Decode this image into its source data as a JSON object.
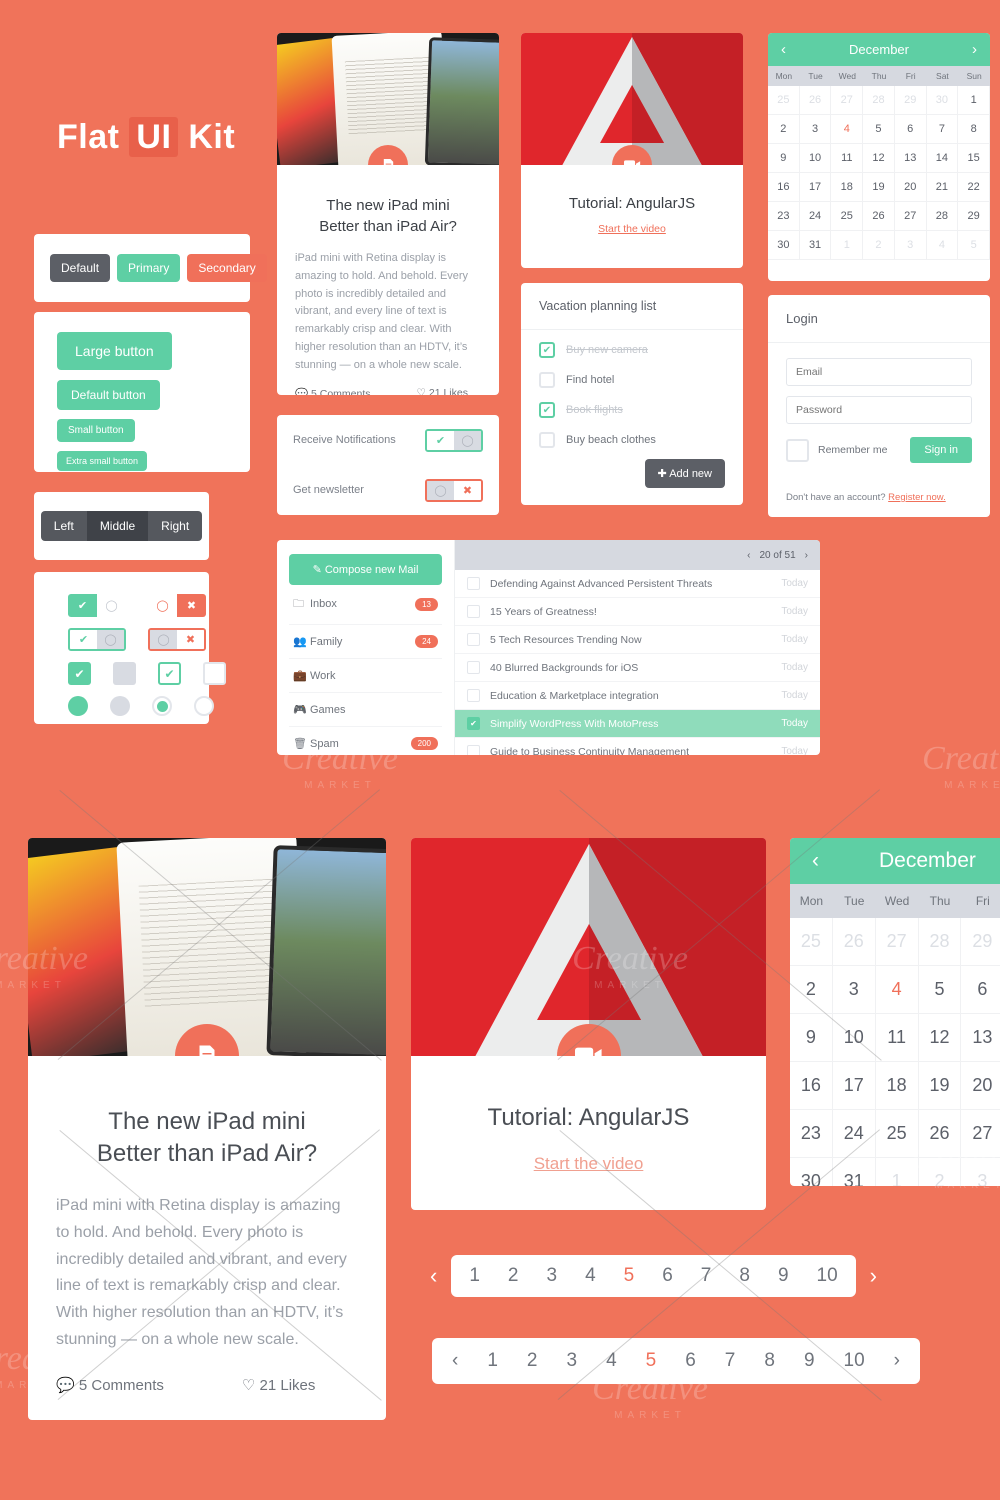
{
  "title": {
    "pre": "Flat ",
    "highlight": "UI",
    "post": " Kit"
  },
  "buttons": {
    "default": "Default",
    "primary": "Primary",
    "secondary": "Secondary"
  },
  "sizes": {
    "large": "Large button",
    "default": "Default button",
    "small": "Small button",
    "xsmall": "Extra small button"
  },
  "segmented": {
    "left": "Left",
    "middle": "Middle",
    "right": "Right"
  },
  "article": {
    "title_line1": "The new iPad mini",
    "title_line2": "Better than iPad Air?",
    "body": "iPad mini with Retina display is amazing to hold. And behold. Every photo is incredibly detailed and vibrant, and every line of text is remarkably crisp and clear. With higher resolution than an HDTV, it’s stunning — on a whole new scale.",
    "comments": "5 Comments",
    "likes": "21 Likes",
    "badge_icon": "document-icon"
  },
  "notifications": {
    "row1_label": "Receive Notifications",
    "row2_label": "Get newsletter"
  },
  "angular": {
    "title": "Tutorial: AngularJS",
    "link": "Start the video",
    "badge_icon": "video-camera-icon"
  },
  "vacation": {
    "header": "Vacation planning list",
    "items": [
      {
        "label": "Buy new camera",
        "checked": true
      },
      {
        "label": "Find hotel",
        "checked": false
      },
      {
        "label": "Book flights",
        "checked": true
      },
      {
        "label": "Buy beach clothes",
        "checked": false
      }
    ],
    "add_label": "Add new"
  },
  "calendar": {
    "month": "December",
    "prev_icon": "chevron-left-icon",
    "next_icon": "chevron-right-icon",
    "dow": [
      "Mon",
      "Tue",
      "Wed",
      "Thu",
      "Fri",
      "Sat",
      "Sun"
    ],
    "weeks": [
      [
        {
          "d": "25",
          "m": true
        },
        {
          "d": "26",
          "m": true
        },
        {
          "d": "27",
          "m": true
        },
        {
          "d": "28",
          "m": true
        },
        {
          "d": "29",
          "m": true
        },
        {
          "d": "30",
          "m": true
        },
        {
          "d": "1"
        }
      ],
      [
        {
          "d": "2"
        },
        {
          "d": "3"
        },
        {
          "d": "4",
          "a": true
        },
        {
          "d": "5"
        },
        {
          "d": "6"
        },
        {
          "d": "7"
        },
        {
          "d": "8"
        }
      ],
      [
        {
          "d": "9"
        },
        {
          "d": "10"
        },
        {
          "d": "11"
        },
        {
          "d": "12"
        },
        {
          "d": "13"
        },
        {
          "d": "14"
        },
        {
          "d": "15"
        }
      ],
      [
        {
          "d": "16"
        },
        {
          "d": "17"
        },
        {
          "d": "18"
        },
        {
          "d": "19"
        },
        {
          "d": "20"
        },
        {
          "d": "21"
        },
        {
          "d": "22"
        }
      ],
      [
        {
          "d": "23"
        },
        {
          "d": "24"
        },
        {
          "d": "25"
        },
        {
          "d": "26"
        },
        {
          "d": "27"
        },
        {
          "d": "28"
        },
        {
          "d": "29"
        }
      ],
      [
        {
          "d": "30"
        },
        {
          "d": "31"
        },
        {
          "d": "1",
          "m": true
        },
        {
          "d": "2",
          "m": true
        },
        {
          "d": "3",
          "m": true
        },
        {
          "d": "4",
          "m": true
        },
        {
          "d": "5",
          "m": true
        }
      ]
    ]
  },
  "login": {
    "header": "Login",
    "email_placeholder": "Email",
    "password_placeholder": "Password",
    "remember_label": "Remember me",
    "signin_label": "Sign in",
    "footer_text": "Don't have an account? ",
    "register_label": "Register now."
  },
  "mail": {
    "compose_label": "Compose new Mail",
    "compose_icon": "pencil-square-icon",
    "folders": [
      {
        "icon": "inbox-icon",
        "label": "Inbox",
        "badge": "13"
      },
      {
        "icon": "people-icon",
        "label": "Family",
        "badge": "24"
      },
      {
        "icon": "briefcase-icon",
        "label": "Work",
        "badge": ""
      },
      {
        "icon": "game-controller-icon",
        "label": "Games",
        "badge": ""
      },
      {
        "icon": "trash-icon",
        "label": "Spam",
        "badge": "200"
      }
    ],
    "pager": "20 of 51",
    "pager_prev_icon": "chevron-left-icon",
    "pager_next_icon": "chevron-right-icon",
    "messages": [
      {
        "subject": "Defending Against Advanced Persistent Threats",
        "time": "Today",
        "selected": false
      },
      {
        "subject": "15 Years of Greatness!",
        "time": "Today",
        "selected": false
      },
      {
        "subject": "5 Tech Resources Trending Now",
        "time": "Today",
        "selected": false
      },
      {
        "subject": "40 Blurred Backgrounds for iOS",
        "time": "Today",
        "selected": false
      },
      {
        "subject": "Education & Marketplace integration",
        "time": "Today",
        "selected": false
      },
      {
        "subject": "Simplify WordPress With MotoPress",
        "time": "Today",
        "selected": true
      },
      {
        "subject": "Guide to Business Continuity Management",
        "time": "Today",
        "selected": false
      }
    ]
  },
  "pagination": {
    "prev_icon": "chevron-left-icon",
    "next_icon": "chevron-right-icon",
    "pages": [
      "1",
      "2",
      "3",
      "4",
      "5",
      "6",
      "7",
      "8",
      "9",
      "10"
    ],
    "active": "5"
  },
  "watermark": {
    "line1": "Creative",
    "line2": "MARKET"
  },
  "colors": {
    "background": "#f0735a",
    "primary_green": "#5ecfa4",
    "secondary_coral": "#f0705a",
    "dark_gray": "#5c5f66",
    "angular_red": "#e0262c"
  }
}
